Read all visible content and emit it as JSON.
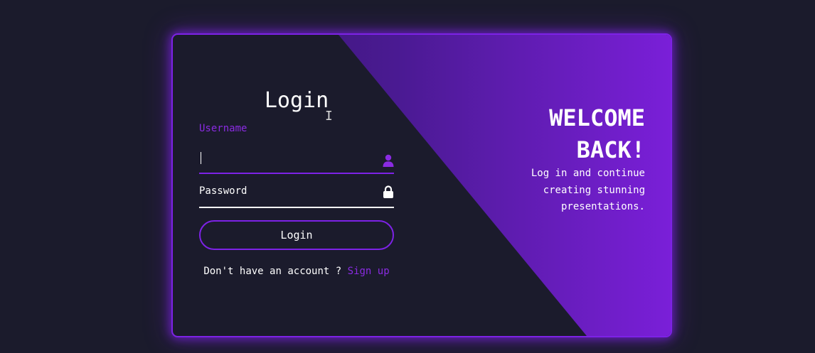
{
  "login_form": {
    "title": "Login",
    "text_cursor": "I",
    "username": {
      "label": "Username",
      "value": "",
      "icon": "user-icon"
    },
    "password": {
      "label": "Password",
      "value": "",
      "icon": "lock-icon"
    },
    "submit_label": "Login",
    "signup_prompt": "Don't have an account ?",
    "signup_link": "Sign up"
  },
  "welcome_panel": {
    "title": "WELCOME\nBACK!",
    "text": "Log in and continue creating stunning presentations."
  },
  "colors": {
    "background": "#1b1b2c",
    "accent": "#7d22e6",
    "accent_text": "#8a2be2",
    "text": "#ffffff"
  }
}
